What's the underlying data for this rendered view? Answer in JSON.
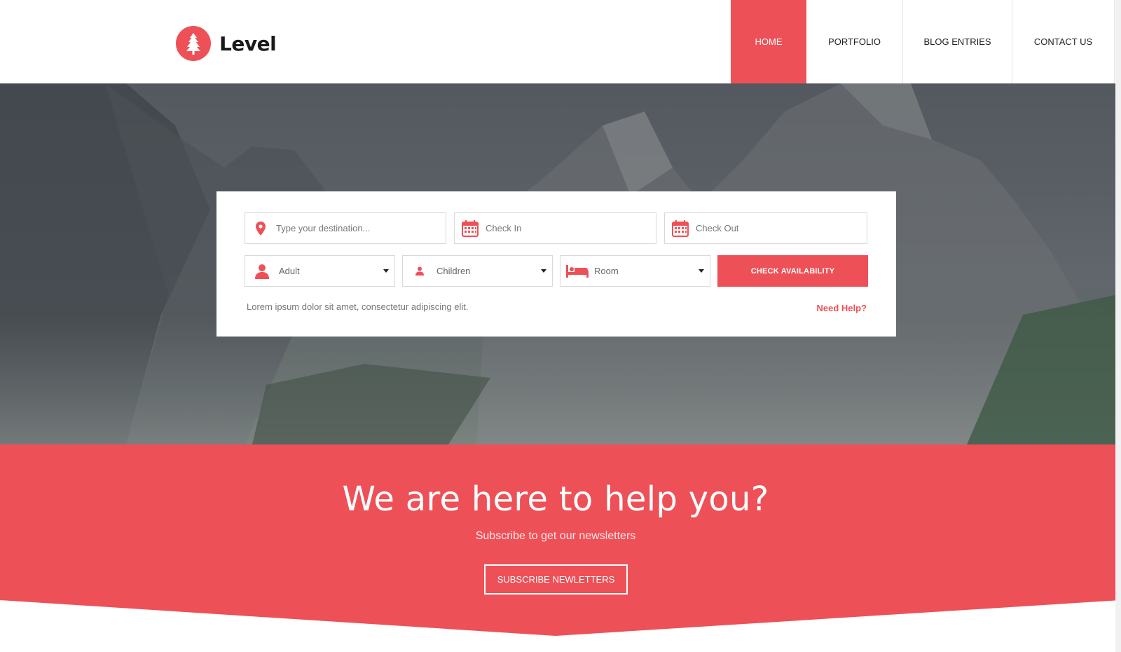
{
  "brand": {
    "name": "Level",
    "color": "#ee5057",
    "logo_icon": "tree-icon"
  },
  "nav": {
    "items": [
      {
        "label": "HOME",
        "active": true
      },
      {
        "label": "PORTFOLIO",
        "active": false
      },
      {
        "label": "BLOG ENTRIES",
        "active": false
      },
      {
        "label": "CONTACT US",
        "active": false
      }
    ]
  },
  "booking": {
    "destination": {
      "placeholder": "Type your destination...",
      "icon": "map-pin-icon"
    },
    "check_in": {
      "placeholder": "Check In",
      "icon": "calendar-icon"
    },
    "check_out": {
      "placeholder": "Check Out",
      "icon": "calendar-icon"
    },
    "adult": {
      "value": "Adult",
      "icon": "user-icon"
    },
    "children": {
      "value": "Children",
      "icon": "child-icon"
    },
    "room": {
      "value": "Room",
      "icon": "bed-icon"
    },
    "submit_label": "CHECK AVAILABILITY",
    "note": "Lorem ipsum dolor sit amet, consectetur adipiscing elit.",
    "help_link": "Need Help?"
  },
  "newsletter": {
    "title": "We are here to help you?",
    "subtitle": "Subscribe to get our newsletters",
    "button_label": "SUBSCRIBE NEWLETTERS"
  }
}
